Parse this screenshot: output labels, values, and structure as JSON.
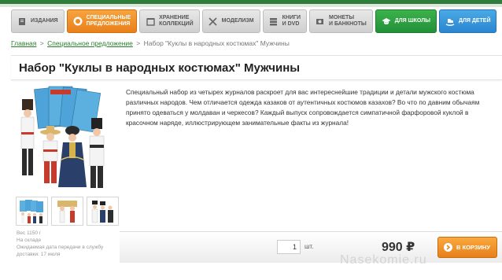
{
  "nav": {
    "items": [
      {
        "label": "ИЗДАНИЯ",
        "icon": "magazine-icon"
      },
      {
        "label": "СПЕЦИАЛЬНЫЕ ПРЕДЛОЖЕНИЯ",
        "line1": "СПЕЦИАЛЬНЫЕ",
        "line2": "ПРЕДЛОЖЕНИЯ",
        "icon": "special-offer-icon"
      },
      {
        "label": "ХРАНЕНИЕ КОЛЛЕКЦИЙ",
        "line1": "ХРАНЕНИЕ",
        "line2": "КОЛЛЕКЦИЙ",
        "icon": "storage-icon"
      },
      {
        "label": "МОДЕЛИЗМ",
        "icon": "tools-icon"
      },
      {
        "label": "КНИГИ И DVD",
        "line1": "КНИГИ",
        "line2": "И DVD",
        "icon": "book-icon"
      },
      {
        "label": "МОНЕТЫ И БАНКНОТЫ",
        "line1": "МОНЕТЫ",
        "line2": "И БАНКНОТЫ",
        "icon": "coins-icon"
      },
      {
        "label": "ДЛЯ ШКОЛЫ",
        "icon": "graduation-cap-icon"
      },
      {
        "label": "ДЛЯ ДЕТЕЙ",
        "icon": "rocking-horse-icon"
      }
    ],
    "colors": {
      "active": "#ef8b22",
      "school": "#2a9c3e",
      "kids": "#3396d9"
    }
  },
  "breadcrumb": {
    "home": "Главная",
    "section": "Специальное предложение",
    "current": "Набор \"Куклы в народных костюмах\" Мужчины",
    "separator": ">"
  },
  "product": {
    "title": "Набор \"Куклы в народных костюмах\" Мужчины",
    "description": "Специальный набор из четырех журналов раскроет для вас интереснейшие традиции и детали мужского костюма различных народов. Чем отличается одежда казаков от аутентичных костюмов казахов? Во что по давним обычаям принято одеваться у молдаван и черкесов? Каждый выпуск сопровождается симпатичной фарфоровой куклой в красочном наряде, иллюстрирующем занимательные факты из журнала!",
    "weight": "Вес 1150 г",
    "availability": "На складе",
    "delivery_line1": "Ожидаемая дата передачи в службу",
    "delivery_line2": "доставки: 17 июля"
  },
  "buy": {
    "quantity": "1",
    "unit": "шт.",
    "price": "990 ₽",
    "cart_label": "В КОРЗИНУ"
  },
  "watermark": "Nasekomie.ru"
}
